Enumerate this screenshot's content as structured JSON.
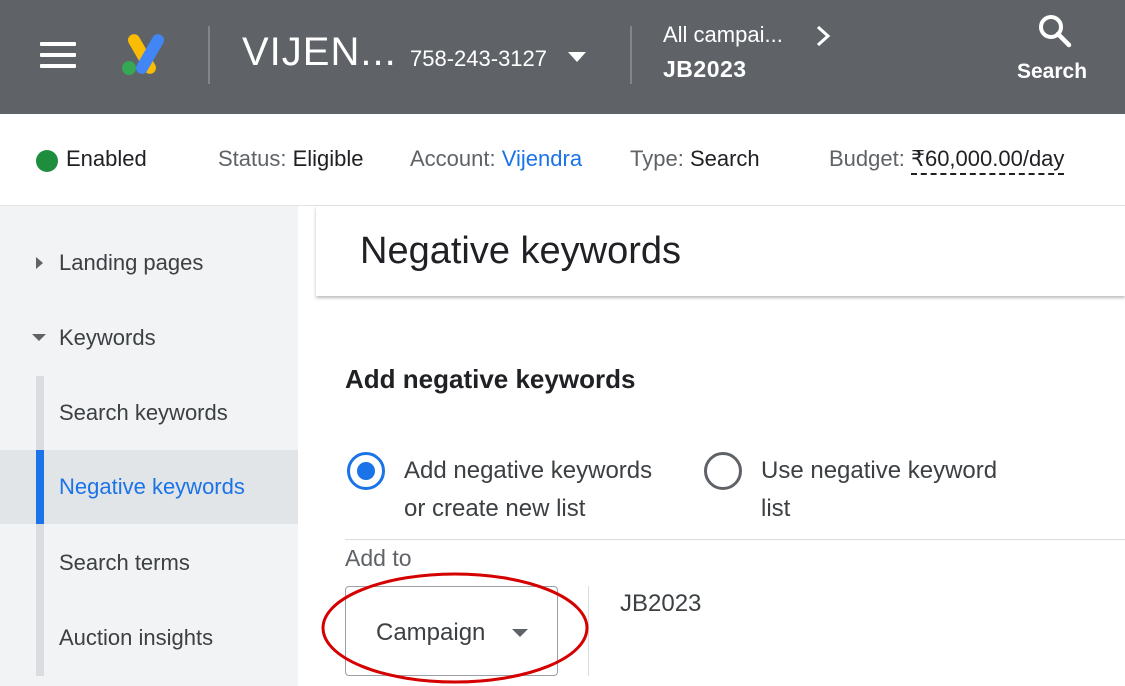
{
  "topbar": {
    "account_name": "VIJEN...",
    "account_id": "758-243-3127",
    "breadcrumb_parent": "All campai...",
    "breadcrumb_current": "JB2023",
    "search_label": "Search",
    "icons": [
      "menu-icon",
      "google-ads-logo",
      "chevron-down-icon",
      "chevron-right-icon",
      "search-icon"
    ]
  },
  "statusbar": {
    "state": "Enabled",
    "status_key": "Status:",
    "status_value": "Eligible",
    "account_key": "Account:",
    "account_value": "Vijendra",
    "type_key": "Type:",
    "type_value": "Search",
    "budget_key": "Budget:",
    "budget_value": "₹60,000.00/day",
    "enabled_color": "#1e8e3e"
  },
  "sidebar": {
    "items": [
      {
        "label": "Landing pages",
        "state": "collapsed"
      },
      {
        "label": "Keywords",
        "state": "expanded"
      },
      {
        "label": "Search keywords"
      },
      {
        "label": "Negative keywords",
        "active": true
      },
      {
        "label": "Search terms"
      },
      {
        "label": "Auction insights"
      }
    ]
  },
  "main": {
    "title": "Negative keywords",
    "section_title": "Add negative keywords",
    "options": [
      {
        "line1": "Add negative keywords",
        "line2": "or create new list",
        "selected": true
      },
      {
        "line1": "Use negative keyword",
        "line2": "list",
        "selected": false
      }
    ],
    "add_to_label": "Add to",
    "level_value": "Campaign",
    "campaign_name": "JB2023"
  },
  "colors": {
    "topbar": "#5f6368",
    "accent": "#1a73e8",
    "annotation": "#d50000"
  }
}
